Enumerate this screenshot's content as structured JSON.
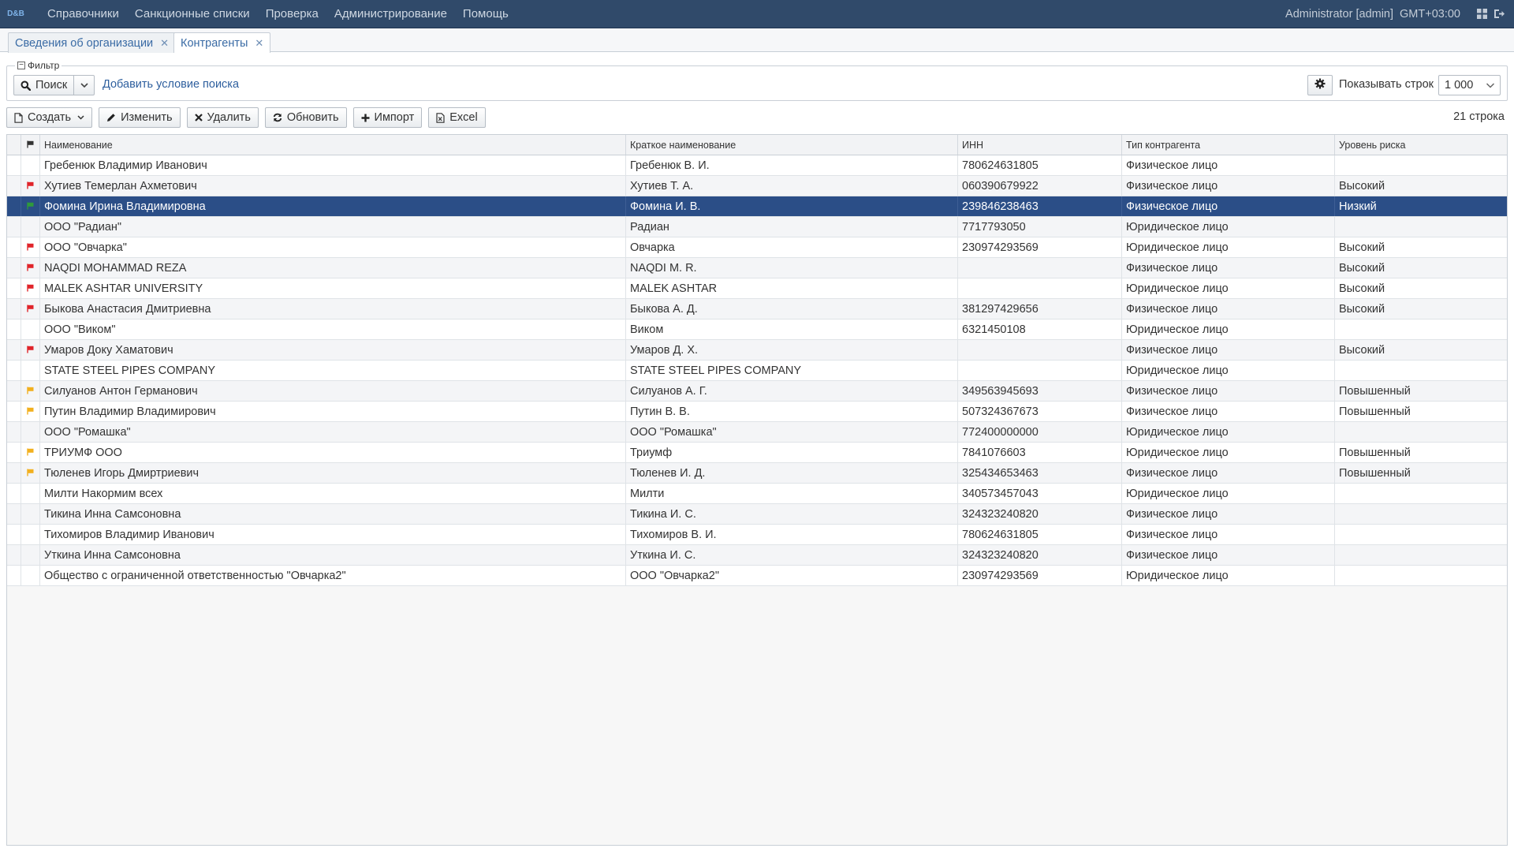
{
  "navbar": {
    "logo_text": "D&B",
    "menu": [
      "Справочники",
      "Санкционные списки",
      "Проверка",
      "Администрирование",
      "Помощь"
    ],
    "user": "Administrator [admin]",
    "timezone": "GMT+03:00",
    "icons": [
      "grid-icon",
      "logout-icon"
    ]
  },
  "tabs": [
    {
      "label": "Сведения об организации",
      "active": false
    },
    {
      "label": "Контрагенты",
      "active": true
    }
  ],
  "filter": {
    "legend": "Фильтр",
    "search_label": "Поиск",
    "add_condition": "Добавить условие поиска",
    "rows_label": "Показывать строк",
    "rows_value": "1 000"
  },
  "toolbar": {
    "create": "Создать",
    "edit": "Изменить",
    "delete": "Удалить",
    "refresh": "Обновить",
    "import": "Импорт",
    "excel": "Excel",
    "row_count": "21 строка"
  },
  "table": {
    "headers": {
      "name": "Наименование",
      "short": "Краткое наименование",
      "inn": "ИНН",
      "type": "Тип контрагента",
      "risk": "Уровень риска"
    },
    "colors": {
      "red": "#e0242a",
      "green": "#2f9a3c",
      "yellow": "#f2b01e",
      "selected": "#2b4e87"
    },
    "rows": [
      {
        "flag": "",
        "name": "Гребенюк Владимир Иванович",
        "short": "Гребенюк В. И.",
        "inn": "780624631805",
        "type": "Физическое лицо",
        "risk": ""
      },
      {
        "flag": "red",
        "name": "Хутиев Темерлан Ахметович",
        "short": "Хутиев Т. А.",
        "inn": "060390679922",
        "type": "Физическое лицо",
        "risk": "Высокий"
      },
      {
        "flag": "green",
        "name": "Фомина Ирина Владимировна",
        "short": "Фомина И. В.",
        "inn": "239846238463",
        "type": "Физическое лицо",
        "risk": "Низкий",
        "selected": true
      },
      {
        "flag": "",
        "name": "ООО \"Радиан\"",
        "short": "Радиан",
        "inn": "7717793050",
        "type": "Юридическое лицо",
        "risk": ""
      },
      {
        "flag": "red",
        "name": "ООО \"Овчарка\"",
        "short": "Овчарка",
        "inn": "230974293569",
        "type": "Юридическое лицо",
        "risk": "Высокий"
      },
      {
        "flag": "red",
        "name": "NAQDI MOHAMMAD REZA",
        "short": "NAQDI M. R.",
        "inn": "",
        "type": "Физическое лицо",
        "risk": "Высокий"
      },
      {
        "flag": "red",
        "name": "MALEK ASHTAR UNIVERSITY",
        "short": "MALEK ASHTAR",
        "inn": "",
        "type": "Юридическое лицо",
        "risk": "Высокий"
      },
      {
        "flag": "red",
        "name": "Быкова Анастасия Дмитриевна",
        "short": "Быкова А. Д.",
        "inn": "381297429656",
        "type": "Физическое лицо",
        "risk": "Высокий"
      },
      {
        "flag": "",
        "name": "ООО \"Виком\"",
        "short": "Виком",
        "inn": "6321450108",
        "type": "Юридическое лицо",
        "risk": ""
      },
      {
        "flag": "red",
        "name": "Умаров Доку Хаматович",
        "short": "Умаров Д. Х.",
        "inn": "",
        "type": "Физическое лицо",
        "risk": "Высокий"
      },
      {
        "flag": "",
        "name": "STATE STEEL PIPES COMPANY",
        "short": "STATE STEEL PIPES COMPANY",
        "inn": "",
        "type": "Юридическое лицо",
        "risk": ""
      },
      {
        "flag": "yellow",
        "name": "Силуанов Антон Германович",
        "short": "Силуанов А. Г.",
        "inn": "349563945693",
        "type": "Физическое лицо",
        "risk": "Повышенный"
      },
      {
        "flag": "yellow",
        "name": "Путин Владимир Владимирович",
        "short": "Путин В. В.",
        "inn": "507324367673",
        "type": "Физическое лицо",
        "risk": "Повышенный"
      },
      {
        "flag": "",
        "name": "ООО \"Ромашка\"",
        "short": "ООО \"Ромашка\"",
        "inn": "772400000000",
        "type": "Юридическое лицо",
        "risk": ""
      },
      {
        "flag": "yellow",
        "name": "ТРИУМФ ООО",
        "short": "Триумф",
        "inn": "7841076603",
        "type": "Юридическое лицо",
        "risk": "Повышенный"
      },
      {
        "flag": "yellow",
        "name": "Тюленев Игорь Дмиртриевич",
        "short": "Тюленев И. Д.",
        "inn": "325434653463",
        "type": "Физическое лицо",
        "risk": "Повышенный"
      },
      {
        "flag": "",
        "name": "Милти Накормим всех",
        "short": "Милти",
        "inn": "340573457043",
        "type": "Юридическое лицо",
        "risk": ""
      },
      {
        "flag": "",
        "name": "Тикина Инна Самсоновна",
        "short": "Тикина И. С.",
        "inn": "324323240820",
        "type": "Физическое лицо",
        "risk": ""
      },
      {
        "flag": "",
        "name": "Тихомиров Владимир Иванович",
        "short": "Тихомиров В. И.",
        "inn": "780624631805",
        "type": "Физическое лицо",
        "risk": ""
      },
      {
        "flag": "",
        "name": "Уткина Инна Самсоновна",
        "short": "Уткина И. С.",
        "inn": "324323240820",
        "type": "Физическое лицо",
        "risk": ""
      },
      {
        "flag": "",
        "name": "Общество с ограниченной ответственностью \"Овчарка2\"",
        "short": "ООО \"Овчарка2\"",
        "inn": "230974293569",
        "type": "Юридическое лицо",
        "risk": ""
      }
    ]
  }
}
